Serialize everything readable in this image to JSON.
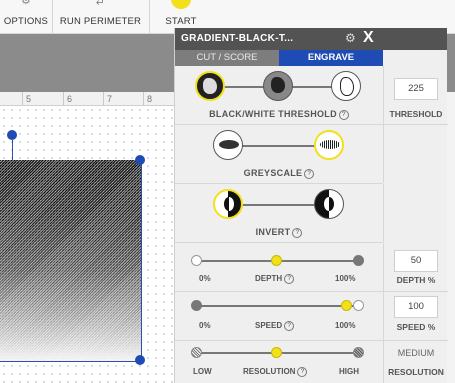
{
  "toolbar": {
    "items": [
      {
        "label": "OPTIONS"
      },
      {
        "label": "RUN PERIMETER"
      },
      {
        "label": "START"
      }
    ]
  },
  "ruler": {
    "marks": [
      "5",
      "6",
      "7",
      "8"
    ]
  },
  "panel": {
    "title": "GRADIENT-BLACK-T...",
    "close_label": "X",
    "tabs": [
      {
        "label": "CUT / SCORE",
        "active": false
      },
      {
        "label": "ENGRAVE",
        "active": true
      }
    ],
    "bw_threshold": {
      "label": "BLACK/WHITE THRESHOLD",
      "selected_index": 0,
      "value": "225",
      "value_label": "THRESHOLD"
    },
    "greyscale": {
      "label": "GREYSCALE",
      "selected_index": 1
    },
    "invert": {
      "label": "INVERT",
      "selected_index": 0
    },
    "depth": {
      "min": "0%",
      "max": "100%",
      "label": "DEPTH",
      "value": "50",
      "value_label": "DEPTH %",
      "fraction": 0.5
    },
    "speed": {
      "min": "0%",
      "max": "100%",
      "label": "SPEED",
      "value": "100",
      "value_label": "SPEED %",
      "fraction": 1.0
    },
    "resolution": {
      "min": "LOW",
      "max": "HIGH",
      "label": "RESOLUTION",
      "value": "MEDIUM",
      "value_label": "RESOLUTION",
      "fraction": 0.5
    }
  },
  "colors": {
    "accent": "#1f4cb4",
    "highlight": "#f2e01a",
    "title_bar": "#535353"
  }
}
